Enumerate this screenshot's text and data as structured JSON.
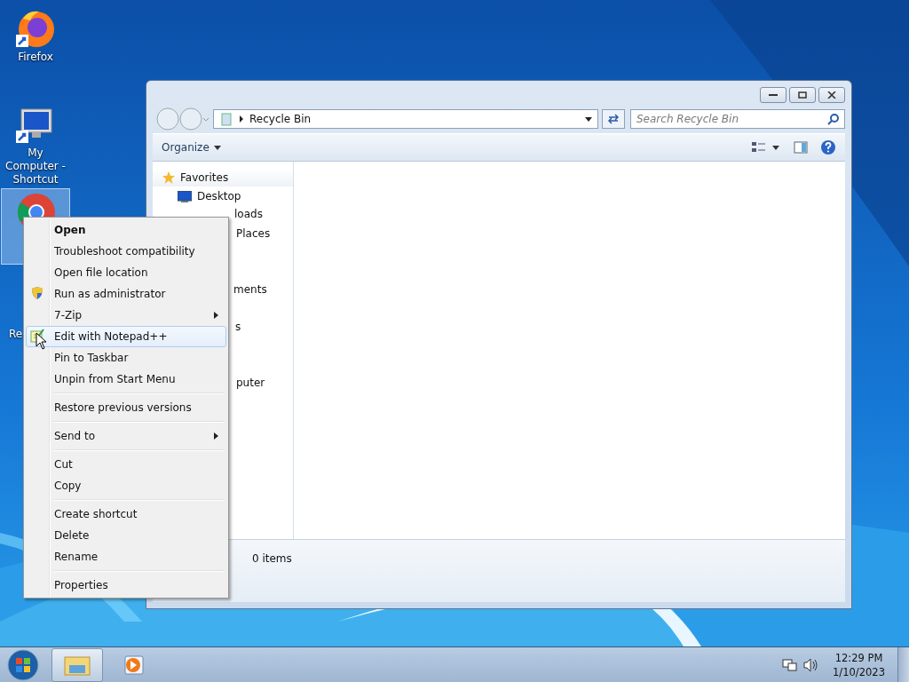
{
  "desktop_icons": [
    {
      "label": "Firefox",
      "kind": "firefox",
      "selected": false
    },
    {
      "label": "My Computer - Shortcut",
      "kind": "computer",
      "selected": false
    },
    {
      "kind": "chrome",
      "selected": true
    },
    {
      "label": "Re",
      "kind": "recycle",
      "selected": false
    }
  ],
  "window": {
    "address": "Recycle Bin",
    "search": {
      "placeholder": "Search Recycle Bin"
    },
    "toolbar": {
      "organize": "Organize"
    },
    "nav_pane": [
      {
        "label": "Favorites",
        "kind": "star"
      },
      {
        "label": "Desktop",
        "kind": "desktop"
      },
      {
        "label": "loads",
        "kind": "text"
      },
      {
        "label": "Places",
        "kind": "text"
      },
      {
        "label": "ments",
        "kind": "text"
      },
      {
        "label": "s",
        "kind": "text"
      },
      {
        "label": "puter",
        "kind": "text"
      }
    ],
    "status": "0 items"
  },
  "context_menu": [
    {
      "kind": "item",
      "label": "Open",
      "bold": true,
      "selected": false
    },
    {
      "kind": "item",
      "label": "Troubleshoot compatibility",
      "selected": false
    },
    {
      "kind": "item",
      "label": "Open file location",
      "selected": false
    },
    {
      "kind": "shield",
      "label": "Run as administrator",
      "selected": false
    },
    {
      "kind": "item",
      "label": "7-Zip",
      "submenu": true,
      "selected": false
    },
    {
      "kind": "notepad",
      "label": "Edit with Notepad++",
      "selected": true
    },
    {
      "kind": "item",
      "label": "Pin to Taskbar",
      "selected": false
    },
    {
      "kind": "item",
      "label": "Unpin from Start Menu",
      "selected": false
    },
    {
      "kind": "separator"
    },
    {
      "kind": "item",
      "label": "Restore previous versions",
      "selected": false
    },
    {
      "kind": "separator"
    },
    {
      "kind": "item",
      "label": "Send to",
      "submenu": true,
      "selected": false
    },
    {
      "kind": "separator"
    },
    {
      "kind": "item",
      "label": "Cut",
      "selected": false
    },
    {
      "kind": "item",
      "label": "Copy",
      "selected": false
    },
    {
      "kind": "separator"
    },
    {
      "kind": "item",
      "label": "Create shortcut",
      "selected": false
    },
    {
      "kind": "item",
      "label": "Delete",
      "selected": false
    },
    {
      "kind": "item",
      "label": "Rename",
      "selected": false
    },
    {
      "kind": "separator"
    },
    {
      "kind": "item",
      "label": "Properties",
      "selected": false
    }
  ],
  "taskbar": {
    "buttons": [
      {
        "kind": "explorer",
        "selected": true
      },
      {
        "kind": "media",
        "selected": false
      }
    ],
    "time": "12:29 PM",
    "date": "1/10/2023"
  }
}
